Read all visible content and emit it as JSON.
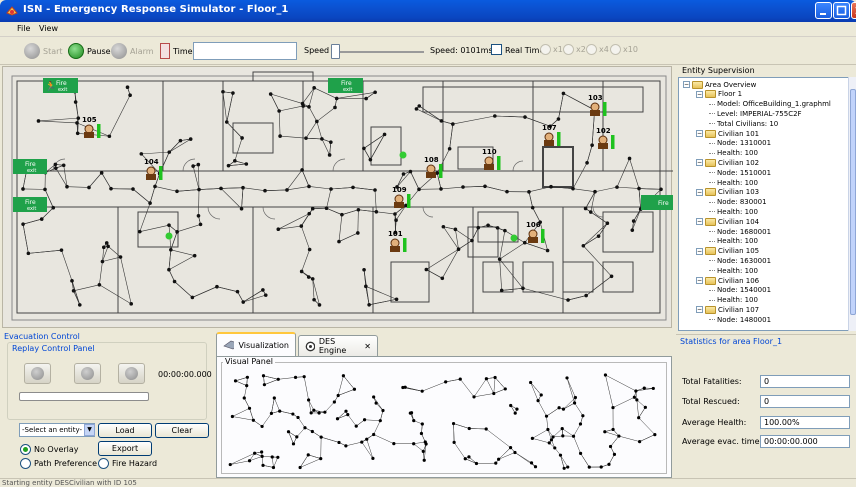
{
  "window": {
    "title": "ISN - Emergency Response Simulator - Floor_1"
  },
  "menu": {
    "file": "File",
    "view": "View"
  },
  "toolbar": {
    "start": "Start",
    "pause": "Pause",
    "alarm": "Alarm",
    "time_label": "Time:",
    "time_value": "",
    "speed_label": "Speed",
    "speed_value": "Speed: 0101ms",
    "realtime_label": "Real Time",
    "speed_multipliers": [
      "x1",
      "x2",
      "x4",
      "x10"
    ]
  },
  "map": {
    "fire_exit_label": "Fire",
    "fire_exit_sub": "exit",
    "civilian_ids": [
      "105",
      "104",
      "107",
      "103",
      "102",
      "108",
      "110",
      "109",
      "101",
      "106"
    ]
  },
  "entity_supervision": {
    "title": "Entity Supervision",
    "tree": [
      {
        "indent": 0,
        "type": "folder",
        "label": "Area Overview"
      },
      {
        "indent": 1,
        "type": "folder",
        "label": "Floor 1"
      },
      {
        "indent": 2,
        "type": "leaf",
        "label": "Model: OfficeBuilding_1.graphml"
      },
      {
        "indent": 2,
        "type": "leaf",
        "label": "Level: IMPERIAL-755C2F"
      },
      {
        "indent": 2,
        "type": "leaf",
        "label": "Total Civilians: 10"
      },
      {
        "indent": 1,
        "type": "folder",
        "label": "Civilian 101"
      },
      {
        "indent": 2,
        "type": "leaf",
        "label": "Node: 1310001"
      },
      {
        "indent": 2,
        "type": "leaf",
        "label": "Health: 100"
      },
      {
        "indent": 1,
        "type": "folder",
        "label": "Civilian 102"
      },
      {
        "indent": 2,
        "type": "leaf",
        "label": "Node: 1510001"
      },
      {
        "indent": 2,
        "type": "leaf",
        "label": "Health: 100"
      },
      {
        "indent": 1,
        "type": "folder",
        "label": "Civilian 103"
      },
      {
        "indent": 2,
        "type": "leaf",
        "label": "Node: 830001"
      },
      {
        "indent": 2,
        "type": "leaf",
        "label": "Health: 100"
      },
      {
        "indent": 1,
        "type": "folder",
        "label": "Civilian 104"
      },
      {
        "indent": 2,
        "type": "leaf",
        "label": "Node: 1680001"
      },
      {
        "indent": 2,
        "type": "leaf",
        "label": "Health: 100"
      },
      {
        "indent": 1,
        "type": "folder",
        "label": "Civilian 105"
      },
      {
        "indent": 2,
        "type": "leaf",
        "label": "Node: 1630001"
      },
      {
        "indent": 2,
        "type": "leaf",
        "label": "Health: 100"
      },
      {
        "indent": 1,
        "type": "folder",
        "label": "Civilian 106"
      },
      {
        "indent": 2,
        "type": "leaf",
        "label": "Node: 1540001"
      },
      {
        "indent": 2,
        "type": "leaf",
        "label": "Health: 100"
      },
      {
        "indent": 1,
        "type": "folder",
        "label": "Civilian 107"
      },
      {
        "indent": 2,
        "type": "leaf",
        "label": "Node: 1480001"
      }
    ]
  },
  "statistics": {
    "title": "Statistics for area Floor_1",
    "rows": [
      {
        "label": "Total Fatalities:",
        "value": "0"
      },
      {
        "label": "Total Rescued:",
        "value": "0"
      },
      {
        "label": "Average Health:",
        "value": "100.00%"
      },
      {
        "label": "Average evac. time:",
        "value": "00:00:00.000"
      }
    ]
  },
  "evacuation": {
    "title": "Evacuation Control",
    "replay_title": "Replay Control Panel",
    "replay_time": "00:00:00.000",
    "replay_progress": 0,
    "entity_select": "-Select an entity-",
    "load": "Load",
    "clear": "Clear",
    "export": "Export",
    "no_overlay": "No Overlay",
    "path_preference": "Path Preference",
    "fire_hazard": "Fire Hazard",
    "selected_overlay": "no_overlay"
  },
  "tabs": {
    "visualization": "Visualization",
    "des_engine": "DES Engine",
    "visual_panel": "Visual Panel"
  },
  "status": {
    "text": "Starting entity DESCivilian with ID 105"
  },
  "colors": {
    "titlebar": "#0a50cf",
    "accent_blue": "#0046d5",
    "exit_green": "#1fa14a",
    "health_green": "#1ec21e",
    "highlight_node": "#33cc33"
  }
}
